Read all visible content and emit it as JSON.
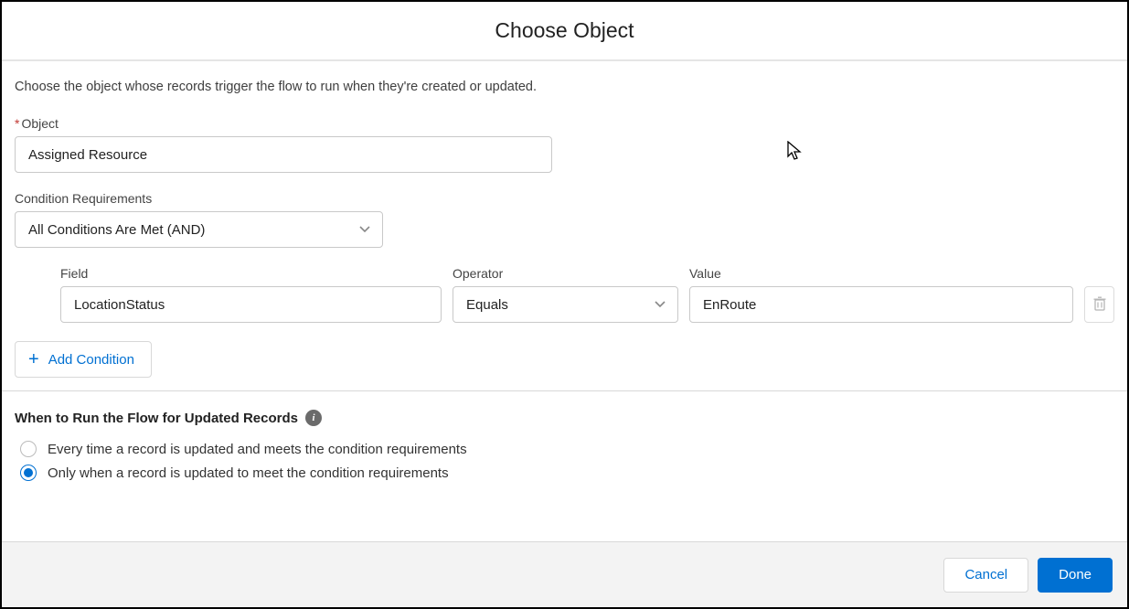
{
  "header": {
    "title": "Choose Object"
  },
  "description": "Choose the object whose records trigger the flow to run when they're created or updated.",
  "objectField": {
    "label": "Object",
    "required_marker": "*",
    "value": "Assigned Resource"
  },
  "conditionRequirements": {
    "label": "Condition Requirements",
    "selected": "All Conditions Are Met (AND)"
  },
  "conditionRow": {
    "fieldLabel": "Field",
    "fieldValue": "LocationStatus",
    "operatorLabel": "Operator",
    "operatorValue": "Equals",
    "valueLabel": "Value",
    "valueValue": "EnRoute"
  },
  "addConditionLabel": "Add Condition",
  "whenToRun": {
    "title": "When to Run the Flow for Updated Records",
    "options": [
      "Every time a record is updated and meets the condition requirements",
      "Only when a record is updated to meet the condition requirements"
    ],
    "selectedIndex": 1
  },
  "footer": {
    "cancel": "Cancel",
    "done": "Done"
  }
}
